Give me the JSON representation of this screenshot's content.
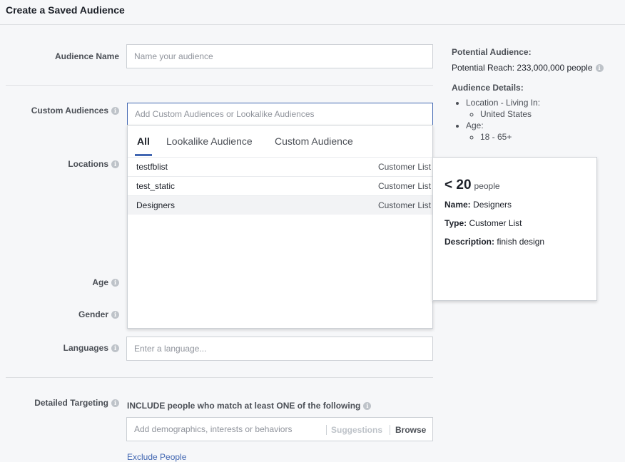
{
  "header": {
    "title": "Create a Saved Audience"
  },
  "form": {
    "audience_name": {
      "label": "Audience Name",
      "placeholder": "Name your audience"
    },
    "custom_audiences": {
      "label": "Custom Audiences",
      "placeholder": "Add Custom Audiences or Lookalike Audiences"
    },
    "locations": {
      "label": "Locations"
    },
    "age": {
      "label": "Age"
    },
    "gender": {
      "label": "Gender"
    },
    "languages": {
      "label": "Languages",
      "placeholder": "Enter a language..."
    },
    "detailed_targeting": {
      "label": "Detailed Targeting",
      "include_text": "INCLUDE people who match at least ONE of the following",
      "placeholder": "Add demographics, interests or behaviors",
      "suggestions_label": "Suggestions",
      "browse_label": "Browse",
      "exclude_link": "Exclude People"
    }
  },
  "dropdown": {
    "tabs": [
      "All",
      "Lookalike Audience",
      "Custom Audience"
    ],
    "items": [
      {
        "name": "testfblist",
        "type": "Customer List"
      },
      {
        "name": "test_static",
        "type": "Customer List"
      },
      {
        "name": "Designers",
        "type": "Customer List"
      }
    ]
  },
  "hovercard": {
    "size": "< 20",
    "size_unit": "people",
    "name_label": "Name:",
    "name_value": "Designers",
    "type_label": "Type:",
    "type_value": "Customer List",
    "desc_label": "Description:",
    "desc_value": "finish design"
  },
  "summary": {
    "potential_audience_title": "Potential Audience:",
    "potential_reach": "Potential Reach: 233,000,000 people",
    "details_title": "Audience Details:",
    "location_label": "Location - Living In:",
    "location_value": "United States",
    "age_label": "Age:",
    "age_value": "18 - 65+"
  },
  "colors": {
    "accent": "#4267b2",
    "background": "#f6f7f9",
    "border": "#ccd0d5"
  },
  "icons": {
    "info": "info-icon"
  }
}
